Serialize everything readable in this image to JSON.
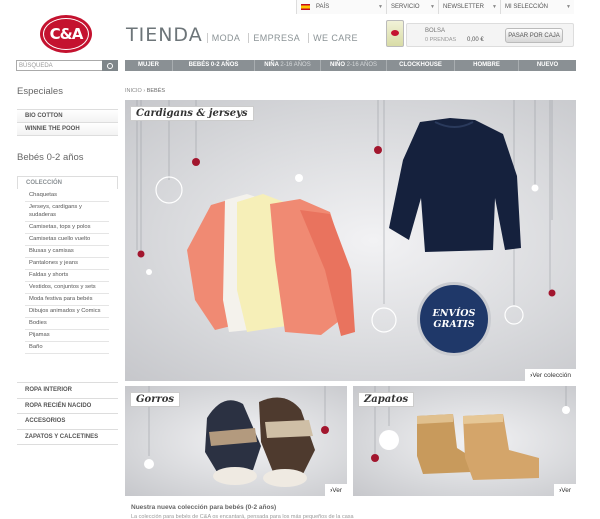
{
  "topbar": {
    "pais": "PAÍS",
    "servicio": "SERVICIO",
    "newsletter": "NEWSLETTER",
    "mi_seleccion": "MI SELECCIÓN"
  },
  "logo": {
    "text": "C&A"
  },
  "brand": {
    "tienda": "TIENDA",
    "moda": "MODA",
    "empresa": "EMPRESA",
    "we_care": "WE CARE"
  },
  "bag": {
    "title": "BOLSA",
    "items": "0 PRENDAS",
    "price": "0,00 €",
    "checkout": "PASAR POR CAJA"
  },
  "search": {
    "placeholder": "BÚSQUEDA"
  },
  "nav": {
    "items": [
      "MUJER",
      "BEBÉS 0-2 AÑOS",
      "NIÑA",
      "NIÑO",
      "CLOCKHOUSE",
      "HOMBRE",
      "NUEVO"
    ],
    "nina_age": "2-16 AÑOS",
    "nino_age": "2-16 AÑOS"
  },
  "breadcrumb": {
    "home": "INICIO",
    "current": "BEBÉS"
  },
  "sidebar": {
    "especiales_title": "Especiales",
    "especiales": [
      "BIO COTTON",
      "WINNIE THE POOH"
    ],
    "bebes_title": "Bebés 0-2 años",
    "coleccion": "COLECCIÓN",
    "subitems": [
      "Chaquetas",
      "Jerseys, cardigans y sudaderas",
      "Camisetas, tops y polos",
      "Camisetas cuello vuelto",
      "Blusas y camisas",
      "Pantalones y jeans",
      "Faldas y shorts",
      "Vestidos, conjuntos y sets",
      "Moda festiva para bebés",
      "Dibujos animados y Comics",
      "Bodies",
      "Pijamas",
      "Baño"
    ],
    "categories": [
      "ROPA INTERIOR",
      "ROPA RECIÉN NACIDO",
      "ACCESORIOS",
      "ZAPATOS Y CALCETINES"
    ]
  },
  "banners": {
    "main_label": "Cardigans & jerseys",
    "main_link": "Ver colección",
    "envios_line1": "ENVÍOS",
    "envios_line2": "GRATIS",
    "gorros_label": "Gorros",
    "gorros_link": "Ver",
    "zapatos_label": "Zapatos",
    "zapatos_link": "Ver"
  },
  "footer": {
    "title": "Nuestra nueva colección para bebés (0-2 años)",
    "text": "La colección para bebés de C&A os encantará, pensada para los más pequeños de la casa"
  },
  "colors": {
    "brand_red": "#c4122f",
    "nav_grey": "#8a9094",
    "envios_navy": "#1f3869"
  }
}
